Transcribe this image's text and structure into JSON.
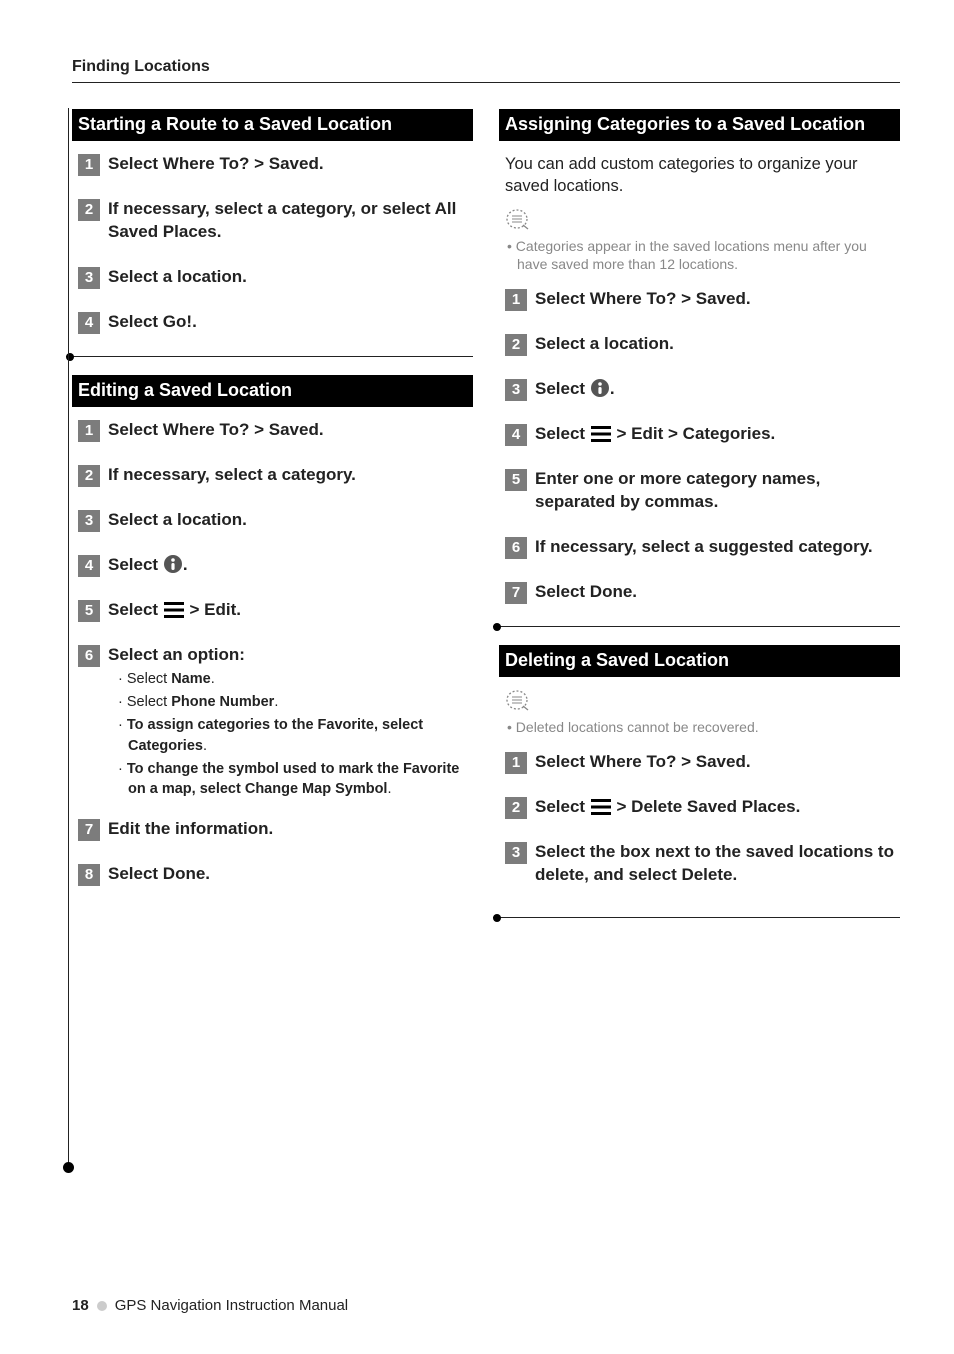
{
  "section_label": "Finding Locations",
  "left": {
    "t1": "Starting a Route to a Saved Location",
    "t1_steps": [
      "Select Where To? > Saved.",
      "If necessary, select a category, or select All Saved Places.",
      "Select a location.",
      "Select Go!."
    ],
    "t2": "Editing a Saved Location",
    "t2_steps": [
      "Select Where To? > Saved.",
      "If necessary, select a category.",
      "Select a location.",
      "Select ",
      "Select ",
      "Select an option:",
      "Edit the information.",
      "Select Done."
    ],
    "t2_step4_tail": ".",
    "t2_step5_tail": " > Edit.",
    "t2_sub": [
      {
        "pre": "Select ",
        "bold": "Name",
        "post": "."
      },
      {
        "pre": "Select ",
        "bold": "Phone Number",
        "post": "."
      },
      {
        "pre": "",
        "bold": "To assign categories to the Favorite, select Categories",
        "post": "."
      },
      {
        "pre": "",
        "bold": "To change the symbol used to mark the Favorite on a map, select Change Map Symbol",
        "post": "."
      }
    ]
  },
  "right": {
    "t1": "Assigning Categories to a Saved Location",
    "t1_intro": "You can add custom categories to organize your saved locations.",
    "t1_note": "Categories appear in the saved locations menu after you have saved more than 12 locations.",
    "t1_steps": [
      "Select Where To? > Saved.",
      "Select a location.",
      "Select ",
      "Select ",
      "Enter one or more category names, separated by commas.",
      "If necessary, select a suggested category.",
      "Select Done."
    ],
    "t1_step3_tail": ".",
    "t1_step4_tail": " > Edit > Categories.",
    "t2": "Deleting a Saved Location",
    "t2_note": "Deleted locations cannot be recovered.",
    "t2_steps": [
      "Select Where To? > Saved.",
      "Select ",
      "Select the box next to the saved locations to delete, and select Delete."
    ],
    "t2_step2_tail": " > Delete Saved Places."
  },
  "footer": {
    "page": "18",
    "title": "GPS Navigation Instruction Manual"
  }
}
